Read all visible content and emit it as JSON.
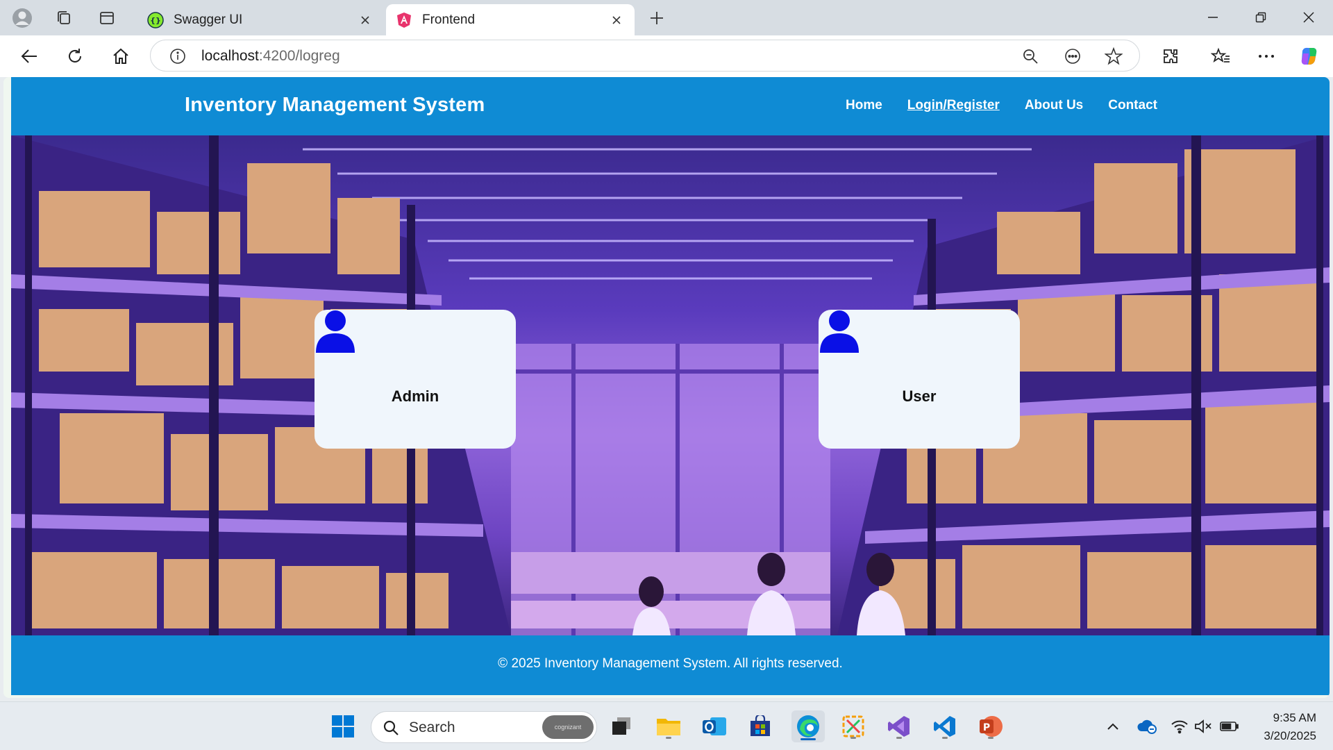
{
  "browser": {
    "tabs": [
      {
        "title": "Swagger UI",
        "favicon": "swagger-icon",
        "active": false
      },
      {
        "title": "Frontend",
        "favicon": "angular-icon",
        "active": true
      }
    ],
    "address": {
      "host": "localhost",
      "path": ":4200/logreg"
    }
  },
  "site": {
    "brand": "Inventory Management System",
    "nav": [
      {
        "label": "Home",
        "active": false
      },
      {
        "label": "Login/Register",
        "active": true
      },
      {
        "label": "About Us",
        "active": false
      },
      {
        "label": "Contact",
        "active": false
      }
    ],
    "cards": [
      {
        "label": "Admin",
        "icon": "person-icon"
      },
      {
        "label": "User",
        "icon": "person-icon"
      }
    ],
    "footer": "© 2025 Inventory Management System. All rights reserved.",
    "colors": {
      "header": "#0f8bd4",
      "person_icon": "#0a10e6",
      "card_bg": "#f0f6fc"
    }
  },
  "taskbar": {
    "search_placeholder": "Search",
    "search_badge": "cognizant",
    "time": "9:35 AM",
    "date": "3/20/2025"
  }
}
